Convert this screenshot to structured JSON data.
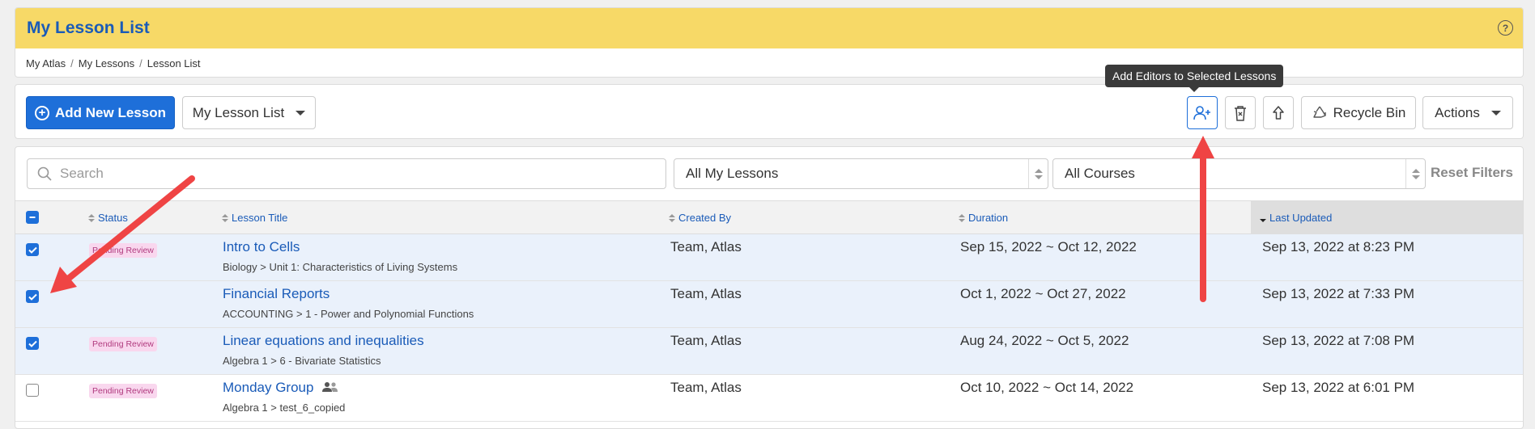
{
  "page": {
    "title": "My Lesson List",
    "help_icon": "question-circle-icon"
  },
  "breadcrumb": [
    "My Atlas",
    "My Lessons",
    "Lesson List"
  ],
  "toolbar": {
    "add_label": "Add New Lesson",
    "list_select": "My Lesson List",
    "tooltip": "Add Editors to Selected Lessons",
    "recycle_label": "Recycle Bin",
    "actions_label": "Actions"
  },
  "filters": {
    "search_placeholder": "Search",
    "lessons_select": "All My Lessons",
    "courses_select": "All Courses",
    "reset_label": "Reset Filters"
  },
  "table": {
    "columns": [
      "Status",
      "Lesson Title",
      "Created By",
      "Duration",
      "Last Updated"
    ],
    "rows": [
      {
        "selected": true,
        "status": "Pending Review",
        "title": "Intro to Cells",
        "subtitle": "Biology > Unit 1: Characteristics of Living Systems",
        "created_by": "Team, Atlas",
        "duration": "Sep 15, 2022 ~ Oct 12, 2022",
        "updated": "Sep 13, 2022 at 8:23 PM"
      },
      {
        "selected": true,
        "status": "",
        "title": "Financial Reports",
        "subtitle": "ACCOUNTING > 1 - Power and Polynomial Functions",
        "created_by": "Team, Atlas",
        "duration": "Oct 1, 2022 ~ Oct 27, 2022",
        "updated": "Sep 13, 2022 at 7:33 PM"
      },
      {
        "selected": true,
        "status": "Pending Review",
        "title": "Linear equations and inequalities",
        "subtitle": "Algebra 1 > 6 - Bivariate Statistics",
        "created_by": "Team, Atlas",
        "duration": "Aug 24, 2022 ~ Oct 5, 2022",
        "updated": "Sep 13, 2022 at 7:08 PM"
      },
      {
        "selected": false,
        "status": "Pending Review",
        "title": "Monday Group",
        "subtitle": "Algebra 1 > test_6_copied",
        "created_by": "Team, Atlas",
        "duration": "Oct 10, 2022 ~ Oct 14, 2022",
        "updated": "Sep 13, 2022 at 6:01 PM"
      }
    ]
  },
  "colors": {
    "header_bar": "#f7d967",
    "primary": "#1e6fd9",
    "annotation_arrow": "#ef4444",
    "selected_row": "#eaf1fb"
  }
}
